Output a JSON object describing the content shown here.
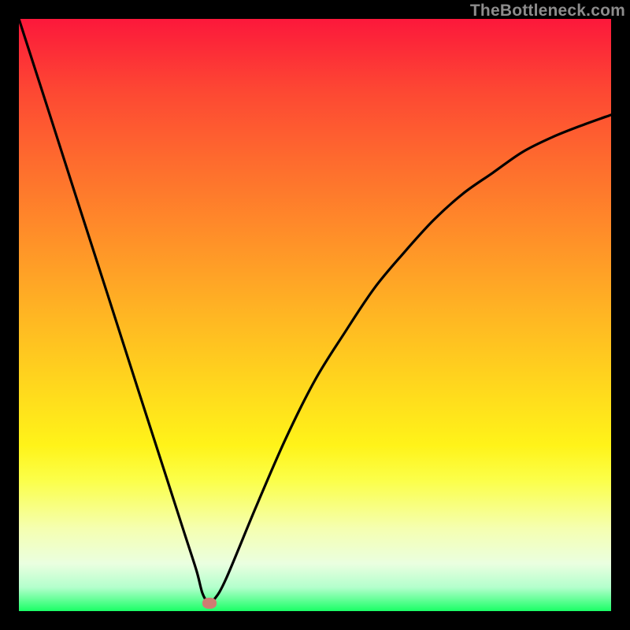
{
  "watermark": "TheBottleneck.com",
  "chart_data": {
    "type": "line",
    "title": "",
    "xlabel": "",
    "ylabel": "",
    "xlim": [
      0,
      1
    ],
    "ylim": [
      0,
      1
    ],
    "grid": false,
    "series": [
      {
        "name": "curve",
        "x": [
          0.0,
          0.05,
          0.1,
          0.15,
          0.2,
          0.25,
          0.28,
          0.3,
          0.31,
          0.32,
          0.33,
          0.35,
          0.4,
          0.45,
          0.5,
          0.55,
          0.6,
          0.65,
          0.7,
          0.75,
          0.8,
          0.85,
          0.9,
          0.95,
          1.0
        ],
        "y": [
          1.0,
          0.845,
          0.689,
          0.534,
          0.378,
          0.223,
          0.13,
          0.068,
          0.03,
          0.015,
          0.02,
          0.055,
          0.175,
          0.29,
          0.39,
          0.47,
          0.545,
          0.605,
          0.66,
          0.705,
          0.74,
          0.775,
          0.8,
          0.82,
          0.838
        ]
      }
    ],
    "marker": {
      "x": 0.322,
      "y": 0.013
    },
    "colors": {
      "curve": "#000000",
      "marker": "#cf7b72",
      "background_top": "#fc183b",
      "background_bottom": "#1aff66"
    }
  }
}
